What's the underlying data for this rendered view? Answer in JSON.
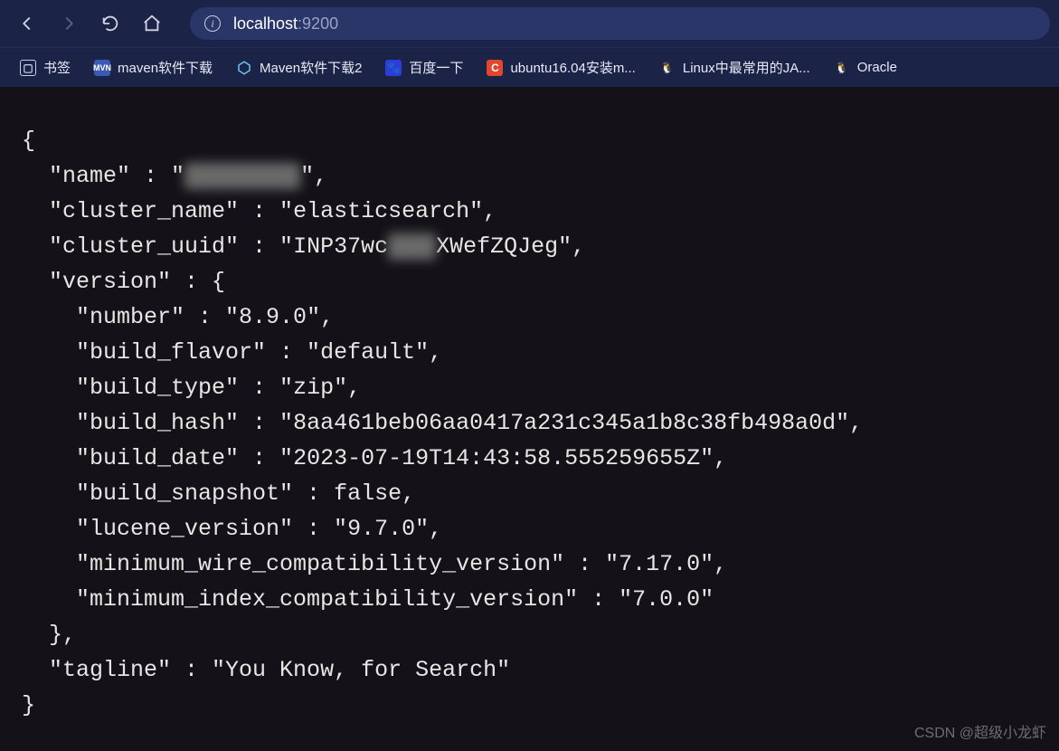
{
  "url": {
    "host": "localhost",
    "port": ":9200"
  },
  "bookmarks": [
    {
      "label": "书签"
    },
    {
      "label": "maven软件下载"
    },
    {
      "label": "Maven软件下载2"
    },
    {
      "label": "百度一下"
    },
    {
      "label": "ubuntu16.04安装m..."
    },
    {
      "label": "Linux中最常用的JA..."
    },
    {
      "label": "Oracle"
    }
  ],
  "json": {
    "name_redacted": "████████",
    "cluster_name": "elasticsearch",
    "cluster_uuid_prefix": "INP37wc",
    "cluster_uuid_redacted": "███",
    "cluster_uuid_suffix": "XWefZQJeg",
    "version": {
      "number": "8.9.0",
      "build_flavor": "default",
      "build_type": "zip",
      "build_hash": "8aa461beb06aa0417a231c345a1b8c38fb498a0d",
      "build_date": "2023-07-19T14:43:58.555259655Z",
      "build_snapshot": "false",
      "lucene_version": "9.7.0",
      "minimum_wire_compatibility_version": "7.17.0",
      "minimum_index_compatibility_version": "7.0.0"
    },
    "tagline": "You Know, for Search"
  },
  "watermark": "CSDN @超级小龙虾"
}
